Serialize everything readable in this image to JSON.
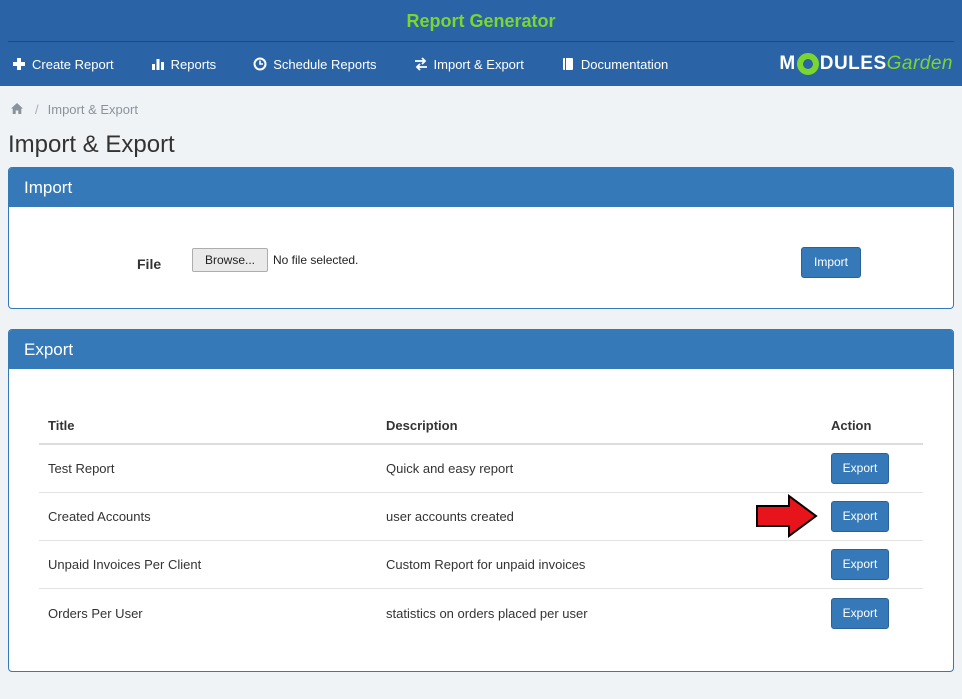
{
  "header": {
    "title": "Report Generator",
    "nav": [
      {
        "label": "Create Report",
        "icon": "plus-icon"
      },
      {
        "label": "Reports",
        "icon": "bar-chart-icon"
      },
      {
        "label": "Schedule Reports",
        "icon": "clock-icon"
      },
      {
        "label": "Import & Export",
        "icon": "exchange-icon"
      },
      {
        "label": "Documentation",
        "icon": "book-icon"
      }
    ],
    "brand": {
      "m": "M",
      "rest": "DULES",
      "garden": "Garden"
    }
  },
  "breadcrumb": {
    "home_icon": "home-icon",
    "current": "Import & Export"
  },
  "page_title": "Import & Export",
  "import_panel": {
    "heading": "Import",
    "file_label": "File",
    "browse_label": "Browse...",
    "file_status": "No file selected.",
    "import_label": "Import"
  },
  "export_panel": {
    "heading": "Export",
    "columns": {
      "title": "Title",
      "description": "Description",
      "action": "Action"
    },
    "rows": [
      {
        "title": "Test Report",
        "description": "Quick and easy report",
        "action": "Export"
      },
      {
        "title": "Created Accounts",
        "description": "user accounts created",
        "action": "Export"
      },
      {
        "title": "Unpaid Invoices Per Client",
        "description": "Custom Report for unpaid invoices",
        "action": "Export"
      },
      {
        "title": "Orders Per User",
        "description": "statistics on orders placed per user",
        "action": "Export"
      }
    ]
  },
  "colors": {
    "header_bg": "#2a64a6",
    "title_green": "#7bd62d",
    "panel_blue": "#3579b8",
    "arrow_red": "#e8141b"
  }
}
